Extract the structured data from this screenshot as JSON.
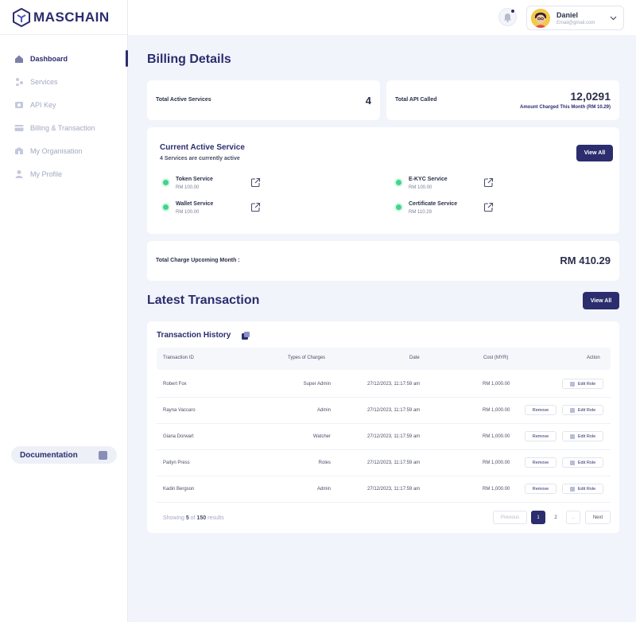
{
  "brand": {
    "name": "MASCHAIN"
  },
  "sidebar": {
    "items": [
      {
        "label": "Dashboard",
        "icon": "home-icon",
        "active": true
      },
      {
        "label": "Services",
        "icon": "services-icon",
        "active": false
      },
      {
        "label": "API Key",
        "icon": "key-icon",
        "active": false
      },
      {
        "label": "Billing & Transaction",
        "icon": "billing-icon",
        "active": false
      },
      {
        "label": "My Organisation",
        "icon": "organisation-icon",
        "active": false
      },
      {
        "label": "My Profile",
        "icon": "profile-icon",
        "active": false
      }
    ],
    "documentation_label": "Documentation"
  },
  "header": {
    "user": {
      "name": "Daniel",
      "email": "Email@gmail.com"
    }
  },
  "billing": {
    "title": "Billing Details",
    "total_active_label": "Total Active Services",
    "total_active_value": "4",
    "api_called_label": "Total API Called",
    "api_called_value": "12,0291",
    "amount_charged_note": "Amount Charged This Month (RM 10.29)"
  },
  "active_service": {
    "title": "Current Active Service",
    "subtitle": "4 Services are currently active",
    "view_all_label": "View All",
    "services": [
      {
        "name": "Token Service",
        "price": "RM 100.00"
      },
      {
        "name": "E-KYC Service",
        "price": "RM 100.00"
      },
      {
        "name": "Wallet Service",
        "price": "RM 100.00"
      },
      {
        "name": "Certificate Service",
        "price": "RM 110.29"
      }
    ]
  },
  "upcoming": {
    "label": "Total Charge Upcoming Month :",
    "value": "RM 410.29"
  },
  "transactions": {
    "section_title": "Latest Transaction",
    "view_all_label": "View All",
    "card_title": "Transaction History",
    "columns": [
      "Transaction ID",
      "Types of Charges",
      "Date",
      "Cost (MYR)",
      "Action"
    ],
    "remove_label": "Remove",
    "edit_label": "Edit Role",
    "rows": [
      {
        "id": "Robert Fox",
        "type": "Super Admin",
        "date": "27/12/2023, 11:17:59 am",
        "cost": "RM 1,000.00",
        "removable": false
      },
      {
        "id": "Rayna Vaccaro",
        "type": "Admin",
        "date": "27/12/2023, 11:17:59 am",
        "cost": "RM 1,000.00",
        "removable": true
      },
      {
        "id": "Giana Dorwart",
        "type": "Watcher",
        "date": "27/12/2023, 11:17:59 am",
        "cost": "RM 1,000.00",
        "removable": true
      },
      {
        "id": "Paityn Press",
        "type": "Roles",
        "date": "27/12/2023, 11:17:59 am",
        "cost": "RM 1,000.00",
        "removable": true
      },
      {
        "id": "Kadin Bergson",
        "type": "Admin",
        "date": "27/12/2023, 11:17:59 am",
        "cost": "RM 1,000.00",
        "removable": true
      }
    ],
    "showing_prefix": "Showing",
    "showing_count": "5",
    "showing_of": "of",
    "showing_total": "150",
    "showing_suffix": "results",
    "pagination": {
      "previous": "Previous",
      "pages": [
        "1",
        "2",
        "..."
      ],
      "current": "1",
      "next": "Next"
    }
  },
  "colors": {
    "brand": "#2b2d6e",
    "active_dot": "#3fd68a",
    "background": "#f2f4fb"
  }
}
